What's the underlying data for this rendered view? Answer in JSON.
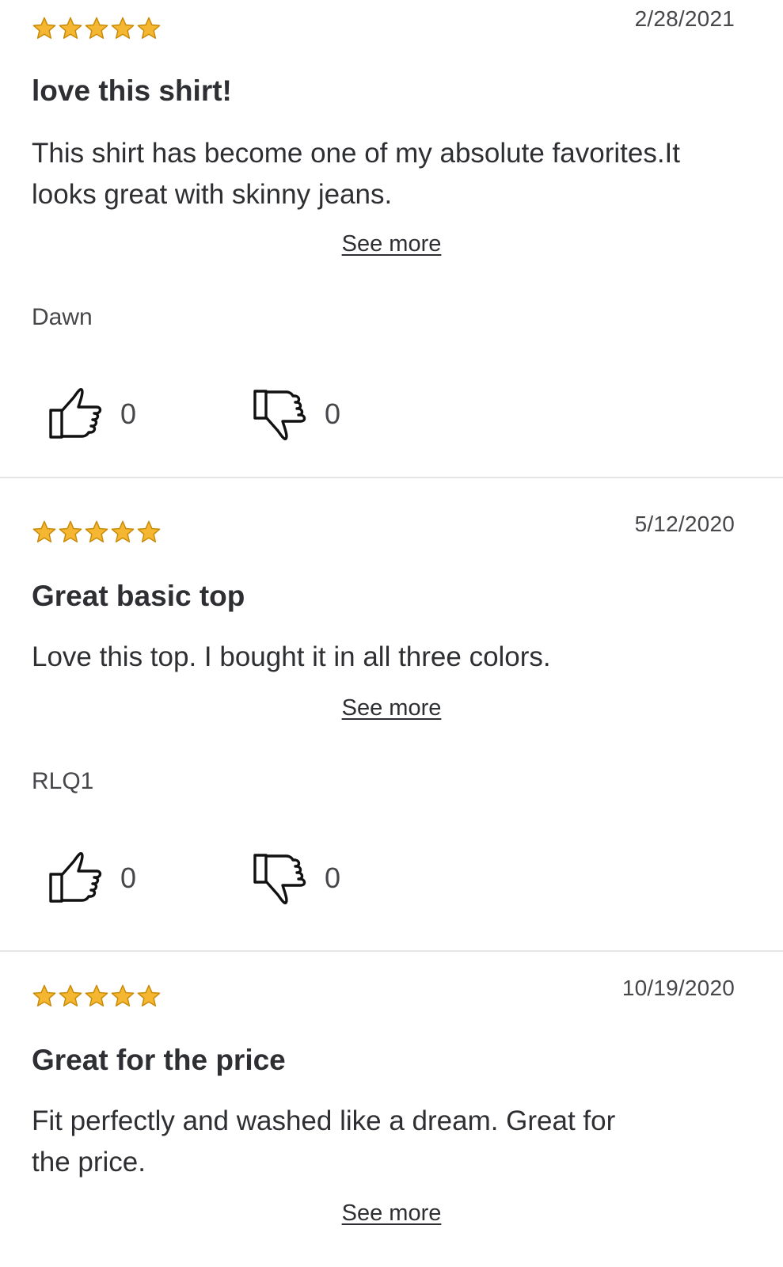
{
  "colors": {
    "star_fill": "#f5b731",
    "star_stroke": "#c98a06",
    "text": "#2e2f32",
    "divider": "#e6e6e6"
  },
  "reviews": [
    {
      "rating": 5,
      "date": "2/28/2021",
      "title": "love this shirt!",
      "body": "This shirt has become one of my absolute favorites.It looks great with skinny jeans.",
      "see_more": "See more",
      "author": "Dawn",
      "helpful_count": "0",
      "unhelpful_count": "0"
    },
    {
      "rating": 5,
      "date": "5/12/2020",
      "title": "Great basic top",
      "body": "Love this top.  I bought it in all three colors.",
      "see_more": "See more",
      "author": "RLQ1",
      "helpful_count": "0",
      "unhelpful_count": "0"
    },
    {
      "rating": 5,
      "date": "10/19/2020",
      "title": "Great for the price",
      "body": "Fit perfectly and washed like a dream.  Great for the price.",
      "see_more": "See more",
      "author": null,
      "helpful_count": null,
      "unhelpful_count": null
    }
  ],
  "icons": {
    "star": "star-icon",
    "thumbs_up": "thumbs-up-icon",
    "thumbs_down": "thumbs-down-icon"
  }
}
